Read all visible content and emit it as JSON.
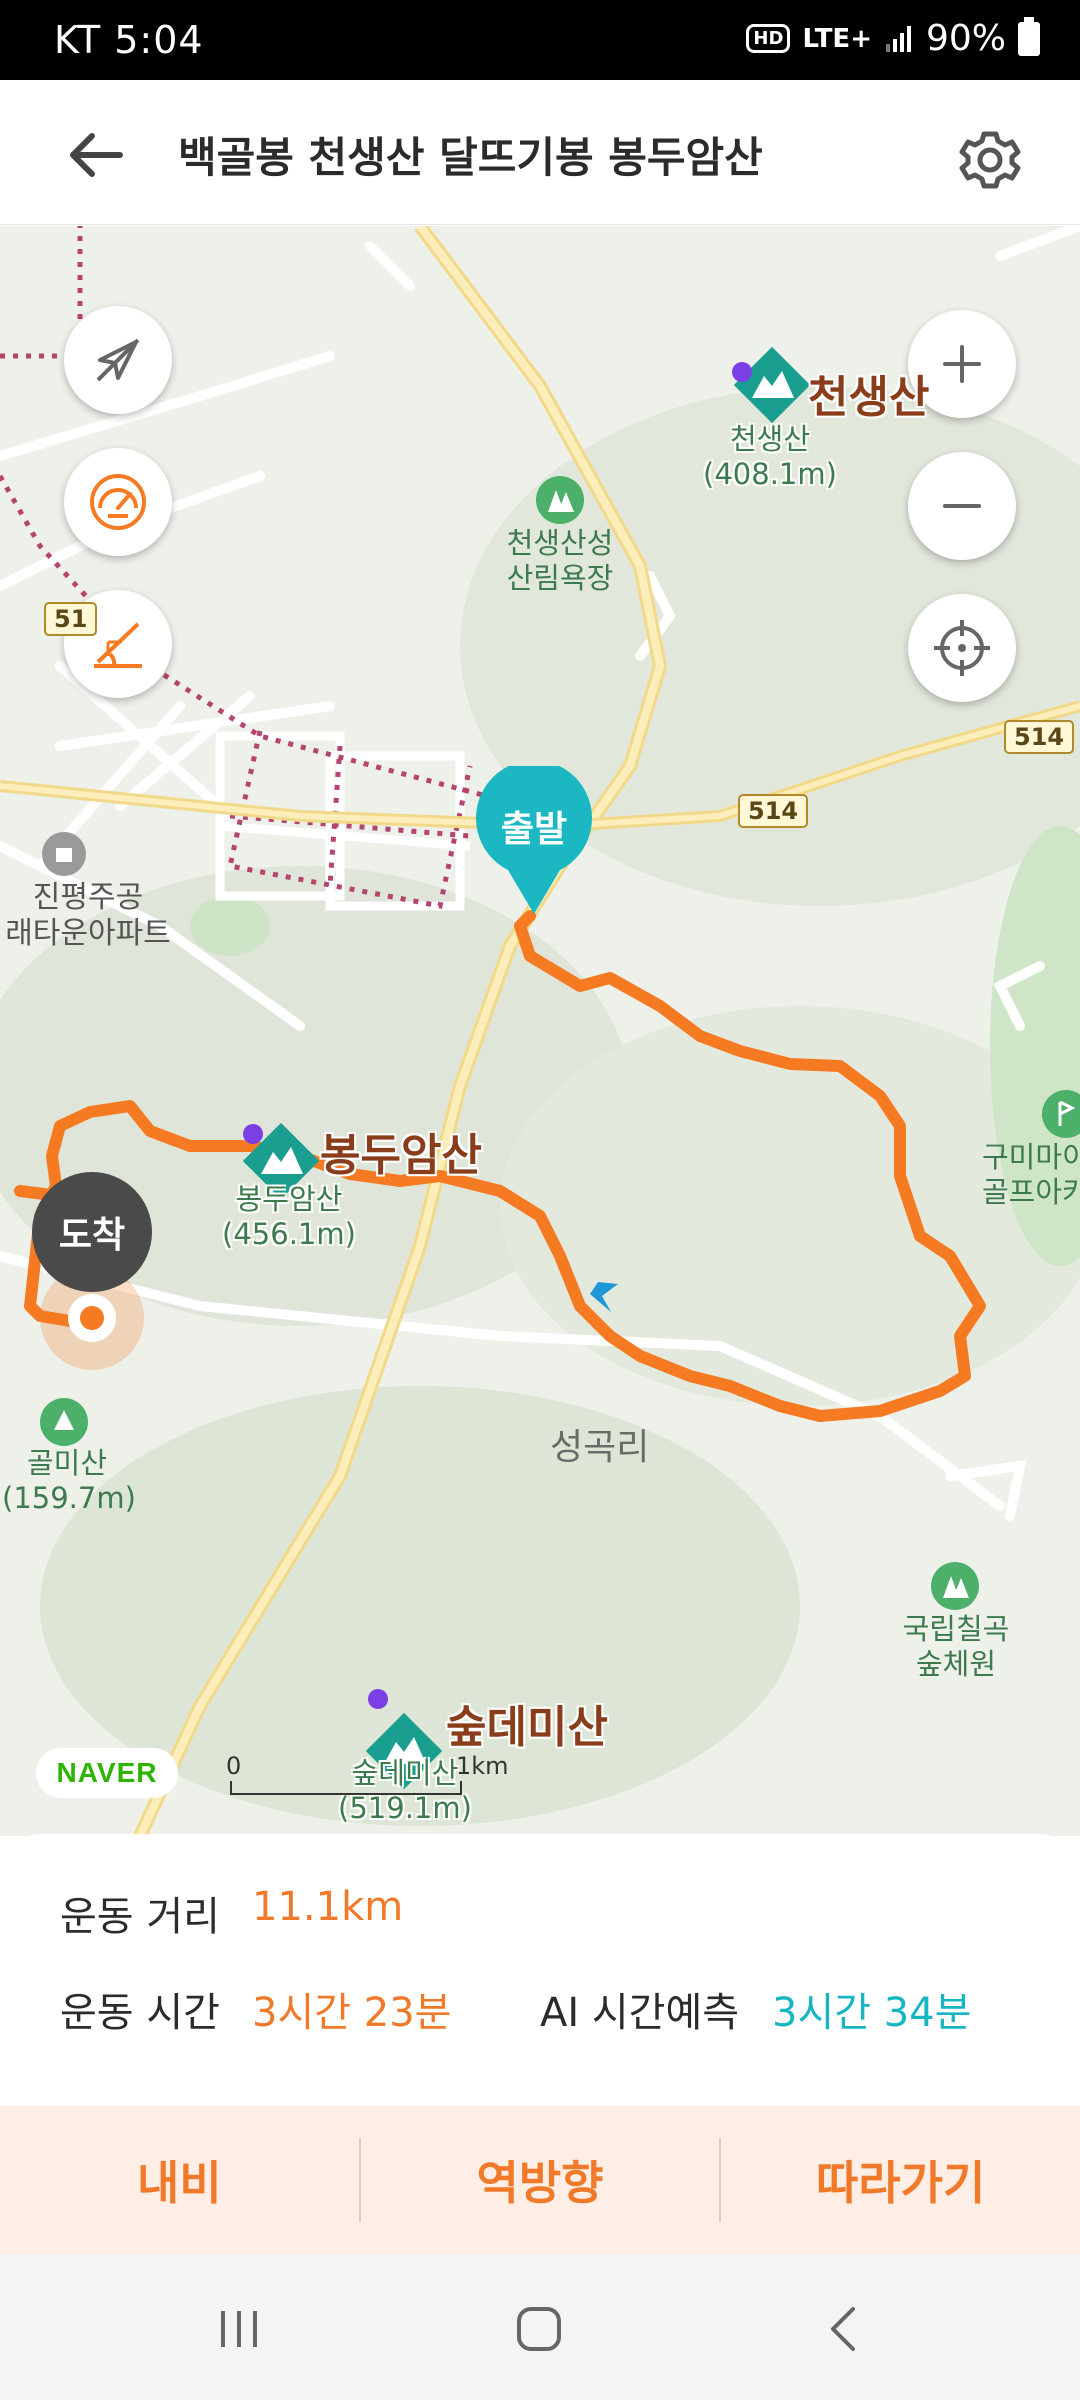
{
  "status_bar": {
    "carrier_time": "KT  5:04",
    "hd": "HD",
    "network": "LTE+",
    "battery": "90%"
  },
  "header": {
    "title": "백골봉 천생산 달뜨기봉 봉두암산",
    "back_icon": "arrow-left-icon",
    "settings_icon": "gear-icon"
  },
  "map": {
    "controls_left": [
      "no-navigation-icon",
      "speedometer-icon",
      "elevation-icon"
    ],
    "controls_right": [
      "zoom-in-icon",
      "zoom-out-icon",
      "locate-icon"
    ],
    "start_label": "출발",
    "end_label": "도착",
    "peaks": [
      {
        "name": "천생산",
        "sub": "천생산",
        "elevation": "(408.1m)"
      },
      {
        "name": "봉두암산",
        "sub": "봉두암산",
        "elevation": "(456.1m)"
      },
      {
        "name": "숲데미산",
        "sub": "숲데미산",
        "elevation": "(519.1m)"
      }
    ],
    "pois": {
      "forest1_line1": "천생산성",
      "forest1_line2": "산림욕장",
      "apt_line1": "진평주공",
      "apt_line2": "래타운아파트",
      "golf_line1": "구미마이",
      "golf_line2": "골프아카",
      "golmi_line1": "골미산",
      "golmi_line2": "(159.7m)",
      "arboretum_line1": "국립칠곡",
      "arboretum_line2": "숲체원",
      "village": "성곡리"
    },
    "road_numbers": [
      "514",
      "514",
      "51"
    ],
    "naver_logo": "NAVER",
    "scale_start": "0",
    "scale_unit": "1km",
    "route_color": "#f57a22",
    "marker_color": "#1bb8c3"
  },
  "stats": {
    "distance_label": "운동 거리",
    "distance_value": "11.1km",
    "time_label": "운동 시간",
    "time_value": "3시간 23분",
    "ai_label": "AI 시간예측",
    "ai_value": "3시간 34분"
  },
  "actions": {
    "navi": "내비",
    "reverse": "역방향",
    "follow": "따라가기"
  },
  "nav_bar": [
    "recent-apps-icon",
    "home-icon",
    "back-icon"
  ]
}
